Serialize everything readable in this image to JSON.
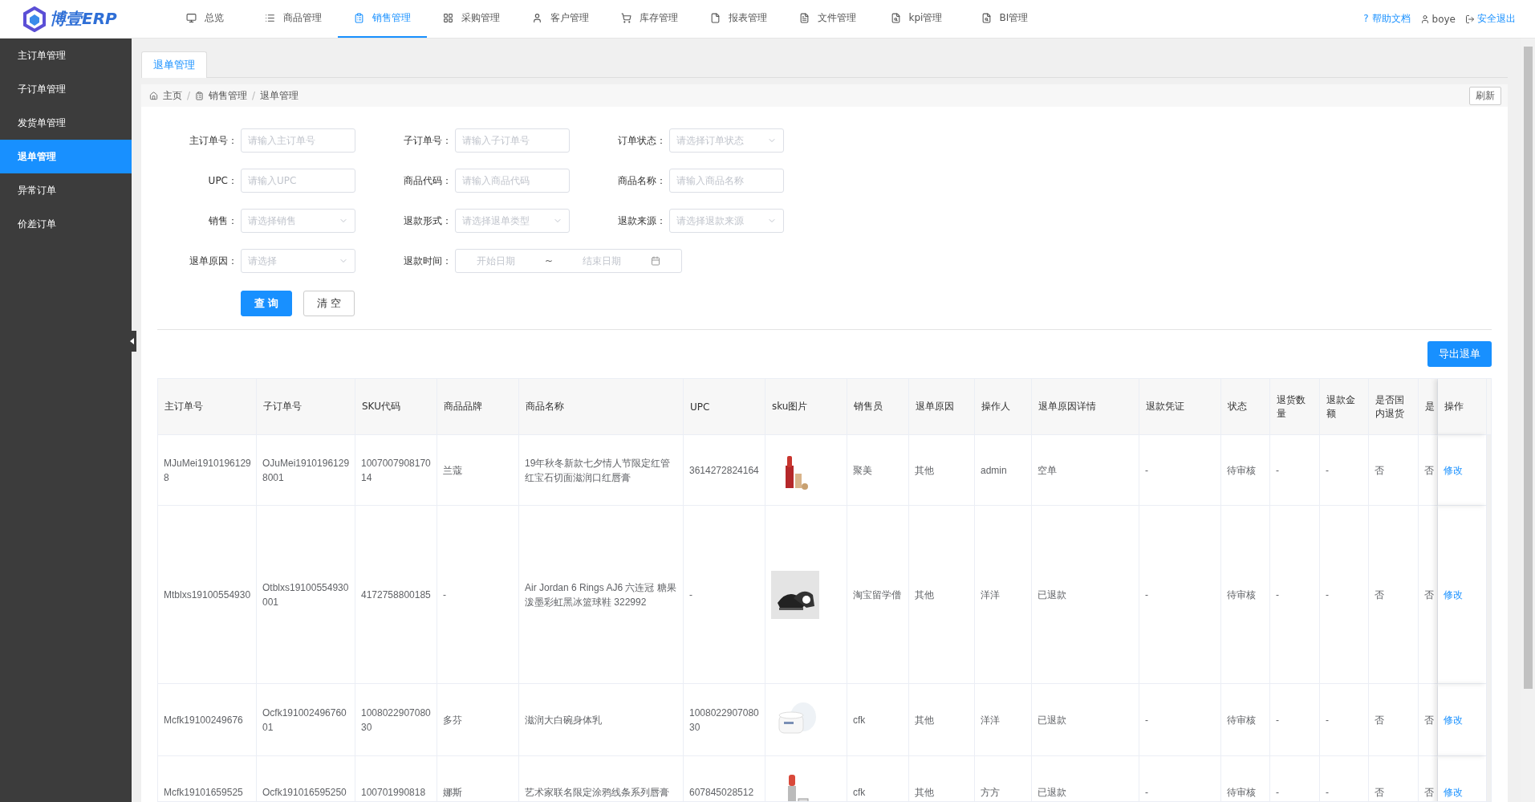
{
  "nav": {
    "logo": "博壹ERP",
    "items": [
      {
        "label": "总览",
        "selected": false
      },
      {
        "label": "商品管理",
        "selected": false
      },
      {
        "label": "销售管理",
        "selected": true
      },
      {
        "label": "采购管理",
        "selected": false
      },
      {
        "label": "客户管理",
        "selected": false
      },
      {
        "label": "库存管理",
        "selected": false
      },
      {
        "label": "报表管理",
        "selected": false
      },
      {
        "label": "文件管理",
        "selected": false
      },
      {
        "label": "kpi管理",
        "selected": false
      },
      {
        "label": "BI管理",
        "selected": false
      }
    ],
    "help": {
      "mark": "?",
      "label": "帮助文档"
    },
    "user": "boye",
    "logout": "安全退出"
  },
  "sidebar": {
    "items": [
      {
        "label": "主订单管理",
        "selected": false
      },
      {
        "label": "子订单管理",
        "selected": false
      },
      {
        "label": "发货单管理",
        "selected": false
      },
      {
        "label": "退单管理",
        "selected": true
      },
      {
        "label": "异常订单",
        "selected": false
      },
      {
        "label": "价差订单",
        "selected": false
      }
    ]
  },
  "tabs": [
    {
      "label": "退单管理",
      "selected": true
    }
  ],
  "breadcrumb": {
    "items": [
      "主页",
      "销售管理",
      "退单管理"
    ],
    "separator": "/"
  },
  "refresh": "刷新",
  "form": {
    "rows": [
      [
        {
          "label": "主订单号：",
          "kind": "input",
          "placeholder": "请输入主订单号"
        },
        {
          "label": "子订单号：",
          "kind": "input",
          "placeholder": "请输入子订单号"
        },
        {
          "label": "订单状态：",
          "kind": "select",
          "placeholder": "请选择订单状态"
        }
      ],
      [
        {
          "label": "UPC：",
          "kind": "input",
          "placeholder": "请输入UPC"
        },
        {
          "label": "商品代码：",
          "kind": "input",
          "placeholder": "请输入商品代码"
        },
        {
          "label": "商品名称：",
          "kind": "input",
          "placeholder": "请输入商品名称"
        }
      ],
      [
        {
          "label": "销售：",
          "kind": "select",
          "placeholder": "请选择销售"
        },
        {
          "label": "退款形式：",
          "kind": "select",
          "placeholder": "请选择退单类型"
        },
        {
          "label": "退款来源：",
          "kind": "select",
          "placeholder": "请选择退款来源"
        }
      ],
      [
        {
          "label": "退单原因：",
          "kind": "select",
          "placeholder": "请选择"
        },
        {
          "label": "退款时间：",
          "kind": "daterange",
          "start_placeholder": "开始日期",
          "separator": "~",
          "end_placeholder": "结束日期"
        }
      ]
    ]
  },
  "buttons": {
    "query": "查 询",
    "clear": "清 空"
  },
  "export": "导出退单",
  "table": {
    "columns": [
      "主订单号",
      "子订单号",
      "SKU代码",
      "商品品牌",
      "商品名称",
      "UPC",
      "sku图片",
      "销售员",
      "退单原因",
      "操作人",
      "退单原因详情",
      "退款凭证",
      "状态",
      "退货数量",
      "退款金额",
      "是否国内退货",
      "是",
      "操作"
    ],
    "rows": [
      {
        "cells": [
          "MJuMei19101961298",
          "OJuMei19101961298001",
          "100700790817014",
          "兰蔻",
          "19年秋冬新款七夕情人节限定红管红宝石切面滋润口红唇膏",
          "3614272824164",
          {
            "kind": "picture"
          },
          "聚美",
          "其他",
          "admin",
          "空单",
          "-",
          "待审核",
          "-",
          "-",
          "否",
          "否"
        ],
        "action": "修改"
      },
      {
        "cells": [
          "Mtblxs19100554930",
          "Otblxs19100554930001",
          "4172758800185",
          "-",
          "Air Jordan 6 Rings AJ6 六连冠 糖果泼墨彩虹黑冰篮球鞋 322992",
          "-",
          {
            "kind": "picture"
          },
          "淘宝留学僧",
          "其他",
          "洋洋",
          "已退款",
          "-",
          "待审核",
          "-",
          "-",
          "否",
          "否"
        ],
        "action": "修改"
      },
      {
        "cells": [
          "Mcfk19100249676",
          "Ocfk19100249676001",
          "100802290708030",
          "多芬",
          "滋润大白碗身体乳",
          "100802290708030",
          {
            "kind": "picture"
          },
          "cfk",
          "其他",
          "洋洋",
          "已退款",
          "-",
          "待审核",
          "-",
          "-",
          "否",
          "否"
        ],
        "action": "修改"
      },
      {
        "cells": [
          "Mcfk19101659525",
          "Ocfk191016595250",
          "100701990818",
          "娜斯",
          "艺术家联名限定涂鸦线条系列唇膏",
          "607845028512",
          {
            "kind": "picture"
          },
          "cfk",
          "其他",
          "方方",
          "已退款",
          "-",
          "待审核",
          "-",
          "-",
          "否",
          "否"
        ],
        "action": "修改"
      }
    ]
  }
}
